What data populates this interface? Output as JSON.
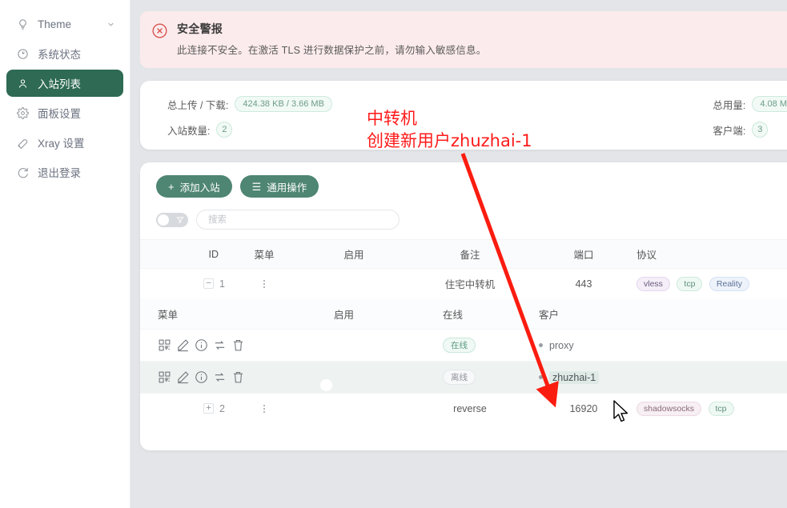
{
  "sidebar": {
    "items": [
      {
        "label": "Theme",
        "icon": "bulb-icon",
        "active": false,
        "chevron": true
      },
      {
        "label": "系统状态",
        "icon": "gauge-icon",
        "active": false,
        "chevron": false
      },
      {
        "label": "入站列表",
        "icon": "user-icon",
        "active": true,
        "chevron": false
      },
      {
        "label": "面板设置",
        "icon": "gear-icon",
        "active": false,
        "chevron": false
      },
      {
        "label": "Xray 设置",
        "icon": "wrench-icon",
        "active": false,
        "chevron": false
      },
      {
        "label": "退出登录",
        "icon": "logout-icon",
        "active": false,
        "chevron": false
      }
    ]
  },
  "alert": {
    "icon": "error-circle-icon",
    "title": "安全警报",
    "message": "此连接不安全。在激活 TLS 进行数据保护之前，请勿输入敏感信息。"
  },
  "stats": {
    "left": [
      {
        "label": "总上传 / 下载:",
        "value": "424.38 KB / 3.66 MB",
        "shape": "pill"
      },
      {
        "label": "入站数量:",
        "value": "2",
        "shape": "circle"
      }
    ],
    "right": [
      {
        "label": "总用量:",
        "value": "4.08 M",
        "shape": "pill"
      },
      {
        "label": "客户端:",
        "value": "3",
        "shape": "circle"
      }
    ]
  },
  "toolbar": {
    "add_label": "添加入站",
    "add_icon": "plus-icon",
    "bulk_label": "通用操作",
    "bulk_icon": "menu-icon"
  },
  "filterbar": {
    "toggle_state": "off",
    "toggle_icon": "funnel-icon",
    "search_placeholder": "搜索",
    "search_value": ""
  },
  "table": {
    "headers": [
      "ID",
      "菜单",
      "启用",
      "备注",
      "端口",
      "协议"
    ],
    "rows": [
      {
        "expander": "−",
        "id": "1",
        "menu_icon": "kebab-menu-icon",
        "enabled": true,
        "remark": "住宅中转机",
        "port": "443",
        "tags": [
          {
            "text": "vless",
            "style": "vless"
          },
          {
            "text": "tcp",
            "style": "tcp"
          },
          {
            "text": "Reality",
            "style": "reality"
          }
        ]
      },
      {
        "expander": "+",
        "id": "2",
        "menu_icon": "kebab-menu-icon",
        "enabled": true,
        "remark": "reverse",
        "port": "16920",
        "tags": [
          {
            "text": "shadowsocks",
            "style": "ss"
          },
          {
            "text": "tcp",
            "style": "tcp"
          }
        ]
      }
    ]
  },
  "subtable": {
    "headers": [
      "菜单",
      "启用",
      "在线",
      "客户"
    ],
    "rows": [
      {
        "actions": [
          "qrcode-icon",
          "edit-icon",
          "info-icon",
          "reset-icon",
          "delete-icon"
        ],
        "enabled": true,
        "status": "在线",
        "status_type": "on",
        "client": "proxy",
        "selected": false
      },
      {
        "actions": [
          "qrcode-icon",
          "edit-icon",
          "info-icon",
          "reset-icon",
          "delete-icon"
        ],
        "enabled": true,
        "status": "离线",
        "status_type": "off",
        "client": "zhuzhai-1",
        "selected": true
      }
    ]
  },
  "annotation": {
    "line1": "中转机",
    "line2": "创建新用户zhuzhai-1",
    "color": "#ff1a1a",
    "arrow": "red-arrow-icon"
  }
}
